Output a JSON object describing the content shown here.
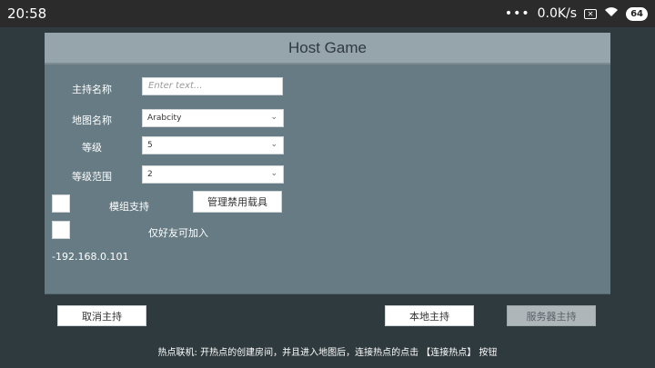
{
  "status": {
    "time": "20:58",
    "dots": "•••",
    "speed": "0.0K/s",
    "sim_icon": "✕",
    "wifi_icon": "wifi-icon",
    "battery": "64"
  },
  "dialog": {
    "title": "Host Game",
    "host_name_label": "主持名称",
    "host_name_placeholder": "Enter text...",
    "map_label": "地图名称",
    "map_value": "Arabcity",
    "level_label": "等级",
    "level_value": "5",
    "level_range_label": "等级范围",
    "level_range_value": "2",
    "mod_support_label": "模组支持",
    "manage_banned_button": "管理禁用载具",
    "friends_only_label": "仅好友可加入",
    "ip_text": "-192.168.0.101",
    "cancel_button": "取消主持",
    "local_host_button": "本地主持",
    "server_host_button": "服务器主持"
  },
  "hint": "热点联机: 开热点的创建房间，并且进入地图后，连接热点的点击 【连接热点】 按钮",
  "colors": {
    "dialog_bg": "#667b83",
    "title_bar": "#96a4ab",
    "footer_bg": "#2f3a3e",
    "page_bg": "#2f3a3e"
  }
}
